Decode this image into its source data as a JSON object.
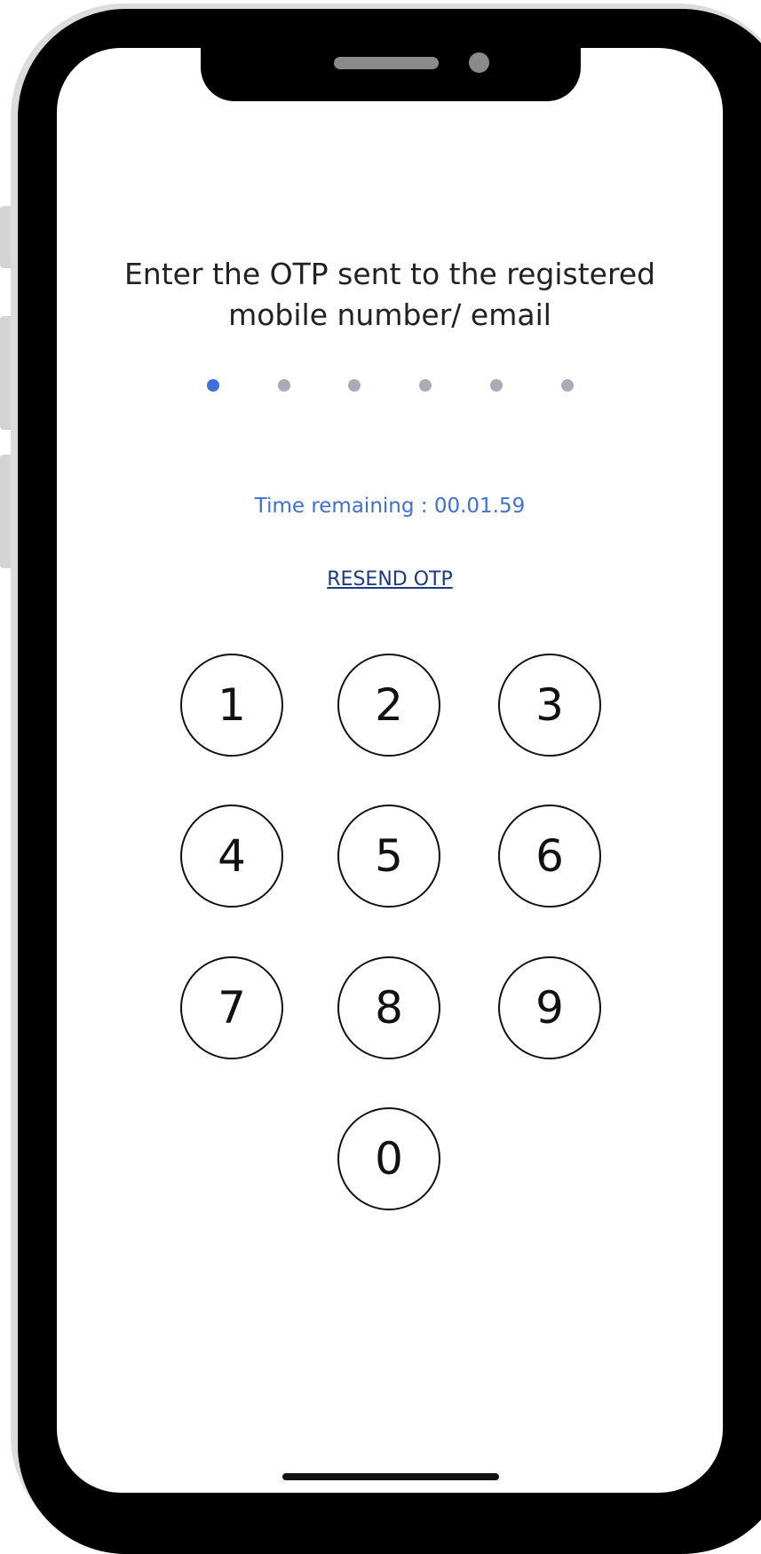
{
  "screen": {
    "prompt_line1": "Enter the OTP sent to the registered",
    "prompt_line2": "mobile number/ email",
    "otp_progress": {
      "total_digits": 6,
      "entered_digits": 1,
      "active_color": "#3f6fd8",
      "inactive_color": "#a9acb6"
    },
    "timer_text": "Time remaining : 00.01.59",
    "resend_label": "RESEND OTP"
  },
  "keypad": {
    "keys": [
      "1",
      "2",
      "3",
      "4",
      "5",
      "6",
      "7",
      "8",
      "9",
      "0"
    ]
  },
  "colors": {
    "accent": "#3f6fd8",
    "link": "#1d3a84",
    "text": "#222222"
  }
}
